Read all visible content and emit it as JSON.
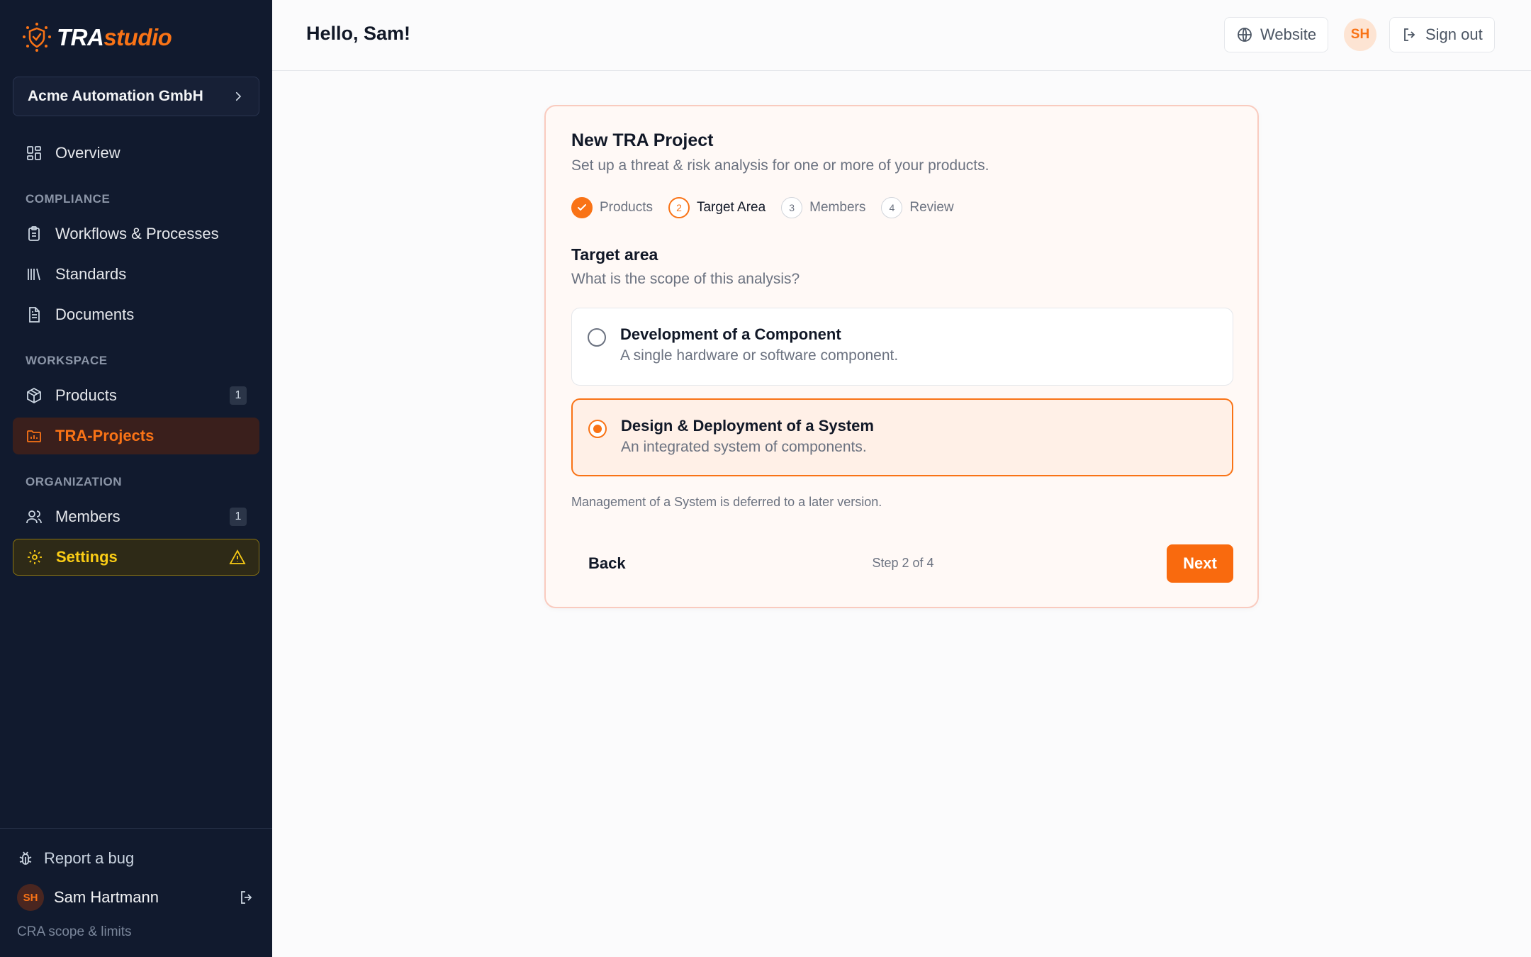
{
  "brand": {
    "name_part1": "TRA",
    "name_part2": "studio",
    "accent_color": "#f97316"
  },
  "sidebar": {
    "org_name": "Acme Automation GmbH",
    "overview": "Overview",
    "sections": {
      "compliance": "COMPLIANCE",
      "workspace": "WORKSPACE",
      "organization": "ORGANIZATION"
    },
    "items": {
      "workflows": "Workflows & Processes",
      "standards": "Standards",
      "documents": "Documents",
      "products": "Products",
      "products_count": "1",
      "tra_projects": "TRA-Projects",
      "members": "Members",
      "members_count": "1",
      "settings": "Settings"
    },
    "footer": {
      "report_bug": "Report a bug",
      "user_initials": "SH",
      "user_name": "Sam Hartmann",
      "cra_link": "CRA scope & limits"
    }
  },
  "header": {
    "greeting": "Hello, Sam!",
    "website": "Website",
    "avatar_initials": "SH",
    "sign_out": "Sign out"
  },
  "wizard": {
    "title": "New TRA Project",
    "subtitle": "Set up a threat & risk analysis for one or more of your products.",
    "steps": [
      {
        "number": "1",
        "label": "Products",
        "state": "done"
      },
      {
        "number": "2",
        "label": "Target Area",
        "state": "current"
      },
      {
        "number": "3",
        "label": "Members",
        "state": "upcoming"
      },
      {
        "number": "4",
        "label": "Review",
        "state": "upcoming"
      }
    ],
    "section_title": "Target area",
    "section_subtitle": "What is the scope of this analysis?",
    "options": [
      {
        "title": "Development of a Component",
        "description": "A single hardware or software component.",
        "selected": false
      },
      {
        "title": "Design & Deployment of a System",
        "description": "An integrated system of components.",
        "selected": true
      }
    ],
    "note": "Management of a System is deferred to a later version.",
    "back": "Back",
    "step_counter": "Step 2 of 4",
    "next": "Next"
  }
}
